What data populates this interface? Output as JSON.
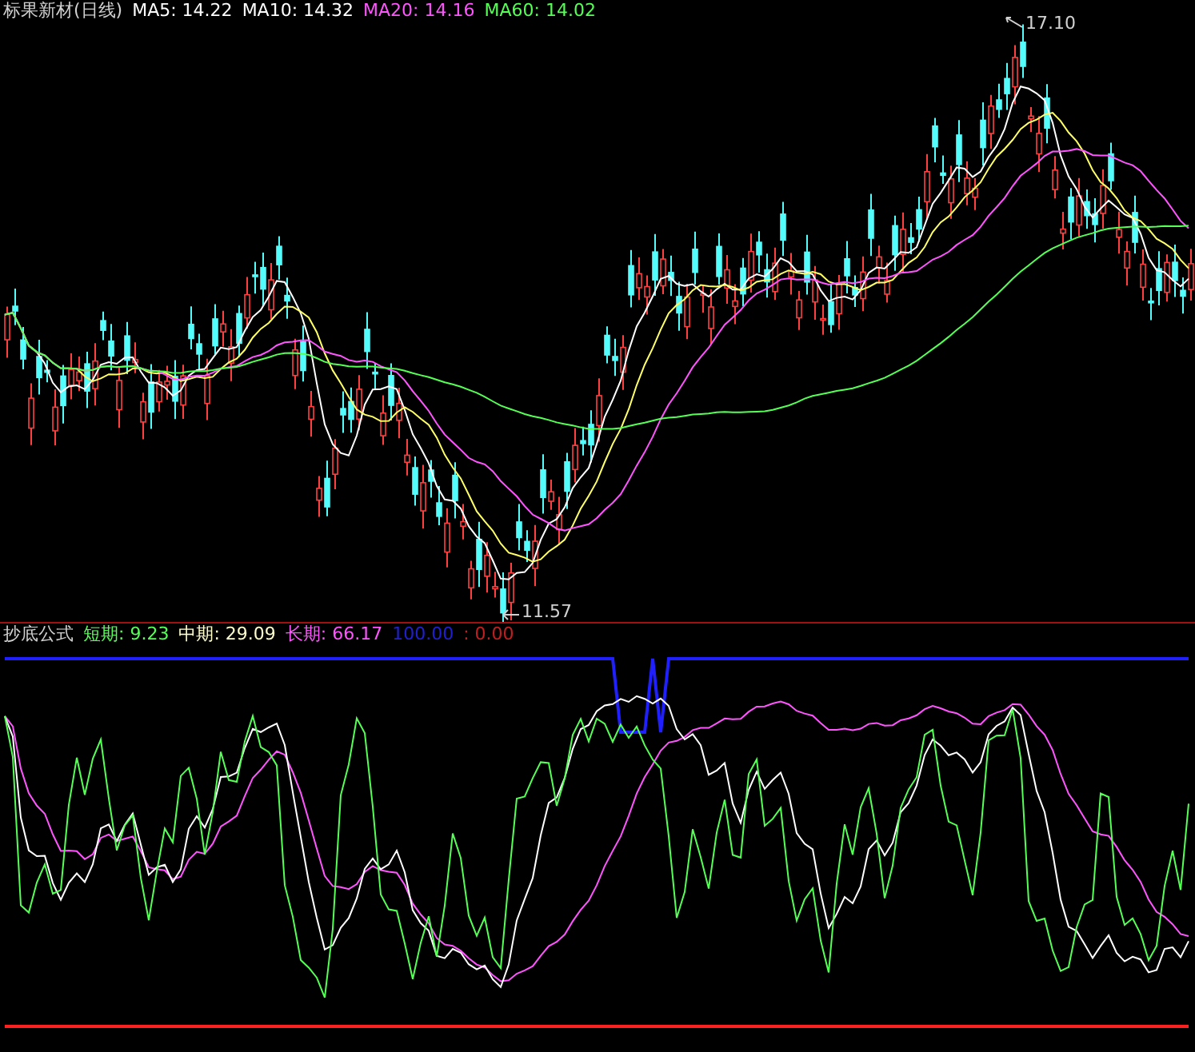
{
  "price_panel": {
    "title": "标果新材(日线)",
    "ma_labels": [
      {
        "label": "MA5: 14.22",
        "color": "#ffffff"
      },
      {
        "label": "MA10: 14.32",
        "color": "#ffffff"
      },
      {
        "label": "MA20: 14.16",
        "color": "#ff55ff"
      },
      {
        "label": "MA60: 14.02",
        "color": "#55ff55"
      }
    ],
    "high_marker": "17.10",
    "low_marker": "11.57"
  },
  "indicator_panel": {
    "name": "抄底公式",
    "readings": [
      {
        "label": "短期:",
        "value": "9.23",
        "color": "#55ff55"
      },
      {
        "label": "中期:",
        "value": "29.09",
        "color": "#ffffcc"
      },
      {
        "label": "长期:",
        "value": "66.17",
        "color": "#ff55ff"
      },
      {
        "value": "100.00",
        "color": "#2020d0"
      },
      {
        "label": ":",
        "value": "0.00",
        "color": "#c02020"
      }
    ]
  }
}
